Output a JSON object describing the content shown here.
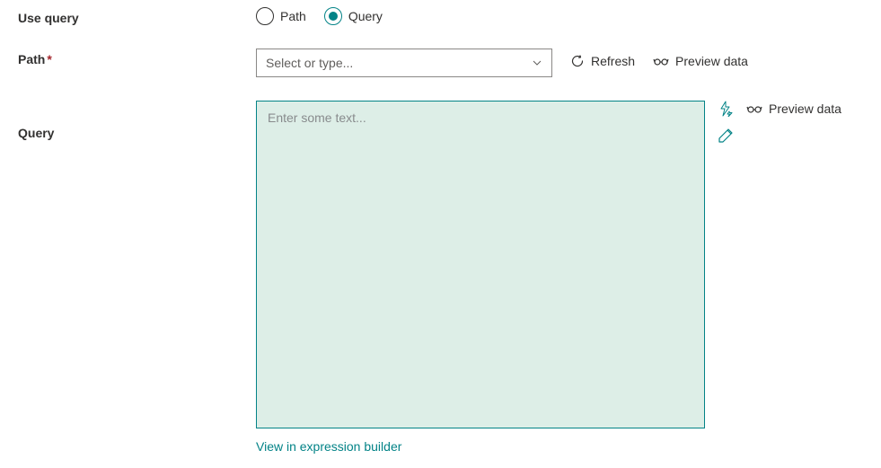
{
  "labels": {
    "use_query": "Use query",
    "path": "Path",
    "query": "Query"
  },
  "radio": {
    "path": "Path",
    "query": "Query",
    "selected": "query"
  },
  "path_select": {
    "placeholder": "Select or type..."
  },
  "actions": {
    "refresh": "Refresh",
    "preview_data": "Preview data"
  },
  "query_textarea": {
    "placeholder": "Enter some text..."
  },
  "links": {
    "expression_builder": "View in expression builder"
  }
}
